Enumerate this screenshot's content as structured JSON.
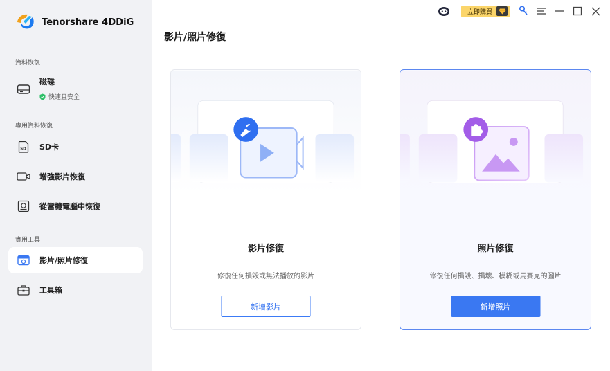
{
  "app": {
    "name": "Tenorshare 4DDiG"
  },
  "titlebar": {
    "buy_label": "立即購買",
    "icons": [
      "support-bot-icon",
      "gem-icon",
      "key-icon",
      "menu-icon",
      "minimize-icon",
      "maximize-icon",
      "close-icon"
    ]
  },
  "sidebar": {
    "sections": [
      {
        "label": "資料恢復"
      },
      {
        "label": "專用資料恢復"
      },
      {
        "label": "實用工具"
      }
    ],
    "disk": {
      "label": "磁碟",
      "status": "快速且安全"
    },
    "items": [
      {
        "label": "SD卡",
        "icon": "sd-card-icon"
      },
      {
        "label": "增強影片恢復",
        "icon": "video-camera-icon"
      },
      {
        "label": "從當機電腦中恢復",
        "icon": "crashed-computer-icon"
      },
      {
        "label": "影片/照片修復",
        "icon": "photo-repair-icon"
      },
      {
        "label": "工具箱",
        "icon": "toolbox-icon"
      }
    ]
  },
  "main": {
    "title": "影片/照片修復",
    "cards": [
      {
        "title": "影片修復",
        "description": "修復任何損毀或無法播放的影片",
        "button": "新增影片"
      },
      {
        "title": "照片修復",
        "description": "修復任何損毀、損壞、模糊或馬賽克的圖片",
        "button": "新增照片"
      }
    ]
  },
  "colors": {
    "accent": "#3a78f2",
    "sidebar_bg": "#f1f2f5",
    "buy_bg": "#fbd56a",
    "safe_green": "#2cbf67",
    "photo_purple": "#a35de8"
  }
}
